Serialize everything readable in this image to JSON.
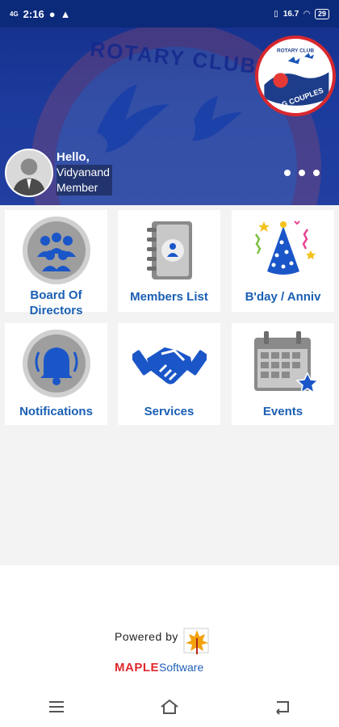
{
  "status_bar": {
    "time": "2:16",
    "network": "4G",
    "speed": "16.7",
    "battery": "29"
  },
  "header": {
    "background_title": "ROTARY CLUB",
    "logo": {
      "top_text": "ROTARY CLUB",
      "bottom_text": "VIZAG COUPLES"
    },
    "greeting": "Hello,",
    "user_name": "Vidyanand",
    "user_role": "Member"
  },
  "menu": [
    {
      "label_line1": "Board Of",
      "label_line2": "Directors",
      "icon": "board-icon"
    },
    {
      "label_line1": "Members List",
      "label_line2": "",
      "icon": "address-book-icon"
    },
    {
      "label_line1": "B'day / Anniv",
      "label_line2": "",
      "icon": "party-hat-icon"
    },
    {
      "label_line1": "Notifications",
      "label_line2": "",
      "icon": "bell-icon"
    },
    {
      "label_line1": "Services",
      "label_line2": "",
      "icon": "handshake-icon"
    },
    {
      "label_line1": "Events",
      "label_line2": "",
      "icon": "calendar-icon"
    }
  ],
  "footer": {
    "powered_by": "Powered by",
    "brand_main": "MAPLE",
    "brand_sub": "Software"
  },
  "colors": {
    "header": "#1c3b9c",
    "label_blue": "#1a5fb4",
    "brand_red": "#e0282e"
  }
}
